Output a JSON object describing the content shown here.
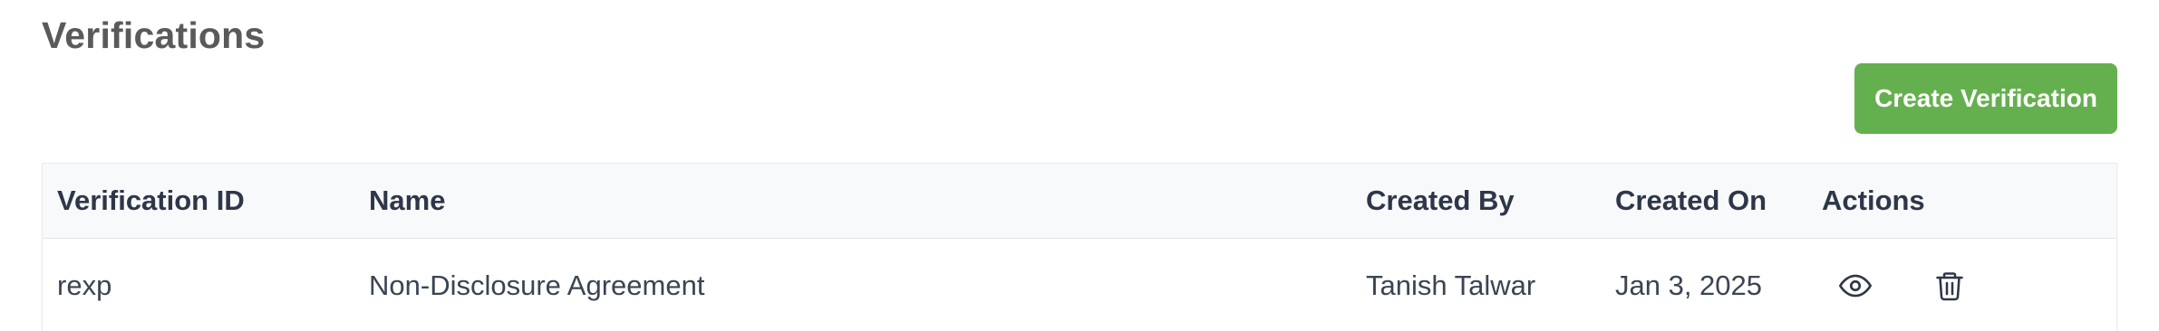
{
  "page": {
    "title": "Verifications"
  },
  "toolbar": {
    "create_label": "Create Verification"
  },
  "table": {
    "columns": [
      "Verification ID",
      "Name",
      "Created By",
      "Created On",
      "Actions"
    ],
    "rows": [
      {
        "id": "rexp",
        "name": "Non-Disclosure Agreement",
        "created_by": "Tanish Talwar",
        "created_on": "Jan 3, 2025",
        "actions": [
          "eye-icon",
          "trash-icon"
        ]
      }
    ]
  },
  "colors": {
    "primary_button": "#65b04e",
    "header_background": "#f8f9fb",
    "title_text": "#5a5a5a",
    "body_text": "#2d3748"
  }
}
